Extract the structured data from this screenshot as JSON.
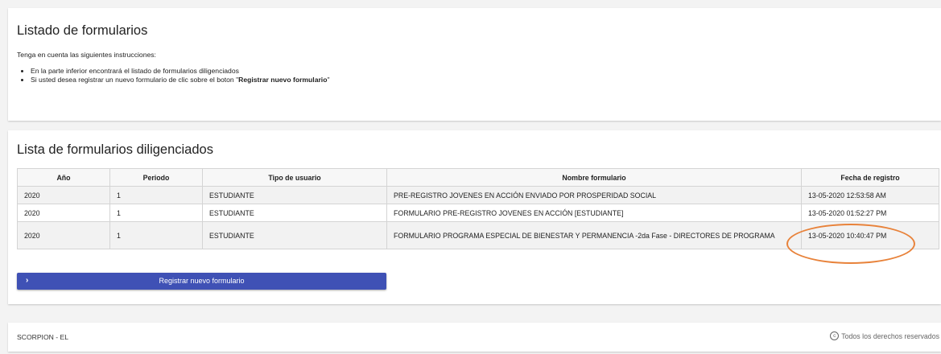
{
  "instructions_card": {
    "title": "Listado de formularios",
    "intro": "Tenga en cuenta las siguientes instrucciones:",
    "bullet1": "En la parte inferior encontrará el listado de formularios diligenciados",
    "bullet2_prefix": "Si usted desea registrar un nuevo formulario de clic sobre el boton \"",
    "bullet2_bold": "Registrar nuevo formulario",
    "bullet2_suffix": "\""
  },
  "list_card": {
    "title": "Lista de formularios diligenciados",
    "columns": [
      "Año",
      "Periodo",
      "Tipo de usuario",
      "Nombre formulario",
      "Fecha de registro"
    ],
    "rows": [
      [
        "2020",
        "1",
        "ESTUDIANTE",
        "PRE-REGISTRO JOVENES EN ACCIÓN ENVIADO POR PROSPERIDAD SOCIAL",
        "13-05-2020 12:53:58 AM"
      ],
      [
        "2020",
        "1",
        "ESTUDIANTE",
        "FORMULARIO PRE-REGISTRO JOVENES EN ACCIÓN [ESTUDIANTE]",
        "13-05-2020 01:52:27 PM"
      ],
      [
        "2020",
        "1",
        "ESTUDIANTE",
        "FORMULARIO PROGRAMA ESPECIAL DE BIENESTAR Y PERMANENCIA -2da Fase - DIRECTORES DE PROGRAMA",
        "13-05-2020 10:40:47 PM"
      ]
    ],
    "register_button": {
      "label": "Registrar nuevo formulario",
      "icon": "chevron-right-icon",
      "color": "#3f51b5"
    },
    "annotation_color": "#e8823a"
  },
  "footer": {
    "left": "SCORPION - EL",
    "copyright_symbol": "c",
    "right": "Todos los derechos reservados"
  }
}
